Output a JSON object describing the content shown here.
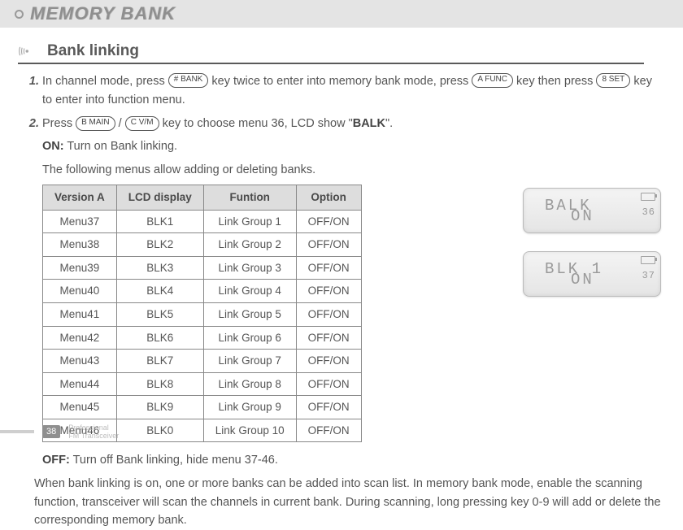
{
  "header": {
    "title": "MEMORY BANK"
  },
  "section": {
    "title": "Bank linking"
  },
  "steps": {
    "s1_a": "In channel mode, press ",
    "s1_b": " key twice to enter into memory bank mode, press ",
    "s1_c": " key then press ",
    "s1_d": " key to enter into function menu.",
    "s2_a": "Press ",
    "s2_slash": " / ",
    "s2_b": " key to choose menu 36, LCD show \"",
    "s2_balk": "BALK",
    "s2_c": "\".",
    "on_label": "ON:",
    "on_text": " Turn on Bank linking.",
    "table_intro": "The following menus allow adding or deleting banks."
  },
  "keys": {
    "bank": "# BANK",
    "func": "A FUNC",
    "set": "8 SET",
    "main": "B MAIN",
    "vm": "C V/M"
  },
  "table": {
    "headers": [
      "Version A",
      "LCD display",
      "Funtion",
      "Option"
    ],
    "rows": [
      [
        "Menu37",
        "BLK1",
        "Link Group 1",
        "OFF/ON"
      ],
      [
        "Menu38",
        "BLK2",
        "Link Group 2",
        "OFF/ON"
      ],
      [
        "Menu39",
        "BLK3",
        "Link Group 3",
        "OFF/ON"
      ],
      [
        "Menu40",
        "BLK4",
        "Link Group 4",
        "OFF/ON"
      ],
      [
        "Menu41",
        "BLK5",
        "Link Group 5",
        "OFF/ON"
      ],
      [
        "Menu42",
        "BLK6",
        "Link Group 6",
        "OFF/ON"
      ],
      [
        "Menu43",
        "BLK7",
        "Link Group 7",
        "OFF/ON"
      ],
      [
        "Menu44",
        "BLK8",
        "Link Group 8",
        "OFF/ON"
      ],
      [
        "Menu45",
        "BLK9",
        "Link Group 9",
        "OFF/ON"
      ],
      [
        "Menu46",
        "BLK0",
        "Link Group 10",
        "OFF/ON"
      ]
    ]
  },
  "lcd": {
    "a": {
      "line1": "BALK",
      "line2": "ON",
      "num": "36"
    },
    "b": {
      "line1": "BLK 1",
      "line2": "ON",
      "num": "37"
    }
  },
  "off": {
    "label": "OFF:",
    "text": " Turn off Bank linking, hide menu 37-46."
  },
  "paragraph": "When bank linking is on, one or more banks can be added into scan list. In memory bank mode, enable the scanning function, transceiver will scan the channels in current bank. During scanning, long pressing key 0-9 will add or delete the corresponding memory bank.",
  "footer": {
    "page": "38",
    "sub1": "Professional",
    "sub2": "FM Transceiver"
  }
}
